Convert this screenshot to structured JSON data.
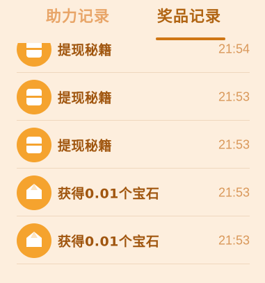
{
  "tabs": {
    "assist_records": "助力记录",
    "prize_records": "奖品记录",
    "active": "prize_records"
  },
  "colors": {
    "background": "#fdeedd",
    "accent": "#cf7614",
    "icon_fill": "#f5a32e",
    "title_text": "#a0560f",
    "time_text": "#d9985a"
  },
  "records": [
    {
      "icon": "book-icon",
      "title": "提现秘籍",
      "time": "21:54"
    },
    {
      "icon": "book-icon",
      "title": "提现秘籍",
      "time": "21:53"
    },
    {
      "icon": "book-icon",
      "title": "提现秘籍",
      "time": "21:53"
    },
    {
      "icon": "gem-icon",
      "title": "获得0.01个宝石",
      "time": "21:53"
    },
    {
      "icon": "gem-icon",
      "title": "获得0.01个宝石",
      "time": "21:53"
    }
  ]
}
